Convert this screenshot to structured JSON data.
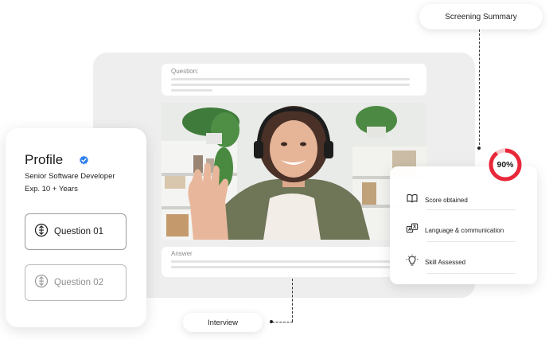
{
  "question_card": {
    "label": "Question:"
  },
  "answer_card": {
    "label": "Answer"
  },
  "profile": {
    "title": "Profile",
    "role": "Senior Software Developer",
    "experience": "Exp. 10 + Years",
    "questions": [
      {
        "label": "Question 01",
        "state": "active"
      },
      {
        "label": "Question 02",
        "state": "inactive"
      }
    ]
  },
  "summary": {
    "score": "90%",
    "score_fraction": 0.9,
    "items": [
      {
        "label": "Score obtained",
        "icon": "open-book-icon"
      },
      {
        "label": "Language & communication",
        "icon": "translate-icon"
      },
      {
        "label": "Skill Assessed",
        "icon": "lightbulb-icon"
      }
    ]
  },
  "pills": {
    "screening_summary": "Screening Summary",
    "interview": "Interview"
  },
  "colors": {
    "accent_red": "#e8283a",
    "verified_blue": "#2f80ed",
    "panel_gray": "#eeeeee"
  }
}
